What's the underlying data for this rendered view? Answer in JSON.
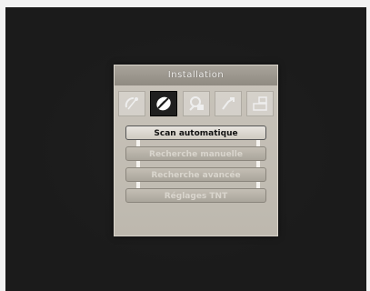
{
  "panel": {
    "title": "Installation"
  },
  "tabs": [
    {
      "icon": "satellite-dish-icon",
      "selected": false
    },
    {
      "icon": "settings-globe-icon",
      "selected": true
    },
    {
      "icon": "parental-lock-icon",
      "selected": false
    },
    {
      "icon": "antenna-icon",
      "selected": false
    },
    {
      "icon": "system-icon",
      "selected": false
    }
  ],
  "menu": {
    "items": [
      {
        "label": "Scan automatique",
        "active": true
      },
      {
        "label": "Recherche manuelle",
        "active": false
      },
      {
        "label": "Recherche avancée",
        "active": false
      },
      {
        "label": "Réglages TNT",
        "active": false
      }
    ]
  },
  "colors": {
    "screen_bg": "#1b1b1b",
    "panel_bg": "#c9c4bb",
    "selected_tab": "#1f1f1f",
    "active_item_text": "#111111",
    "inactive_item_text": "#d9d5cd"
  }
}
